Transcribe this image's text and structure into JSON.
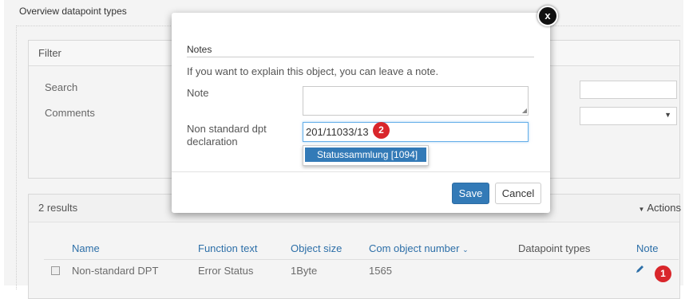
{
  "page": {
    "title": "Overview datapoint types",
    "filter": {
      "heading": "Filter",
      "search_label": "Search",
      "comments_label": "Comments"
    },
    "results": {
      "count_label": "2 results",
      "actions_label": "Actions",
      "columns": [
        "Name",
        "Function text",
        "Object size",
        "Com object number",
        "Datapoint types",
        "Note"
      ],
      "rows": [
        {
          "name": "Non-standard DPT",
          "function_text": "Error Status",
          "object_size": "1Byte",
          "com_object_number": "1565",
          "datapoint_types": ""
        }
      ]
    },
    "badge_1": "1"
  },
  "modal": {
    "section_title": "Notes",
    "description": "If you want to explain this object, you can leave a note.",
    "note_label": "Note",
    "note_value": "",
    "dpt_label_line1": "Non standard dpt",
    "dpt_label_line2": "declaration",
    "dpt_value": "201/11033/13",
    "badge_2": "2",
    "autocomplete_option": "Statussammlung [1094]",
    "save_label": "Save",
    "cancel_label": "Cancel",
    "close_glyph": "x"
  },
  "colors": {
    "accent": "#337ab7",
    "badge": "#d9262b",
    "link": "#2d6fa8"
  },
  "icons": [
    "close-icon",
    "pencil-icon",
    "caret-down-icon",
    "sort-caret-icon",
    "checkbox-icon"
  ]
}
